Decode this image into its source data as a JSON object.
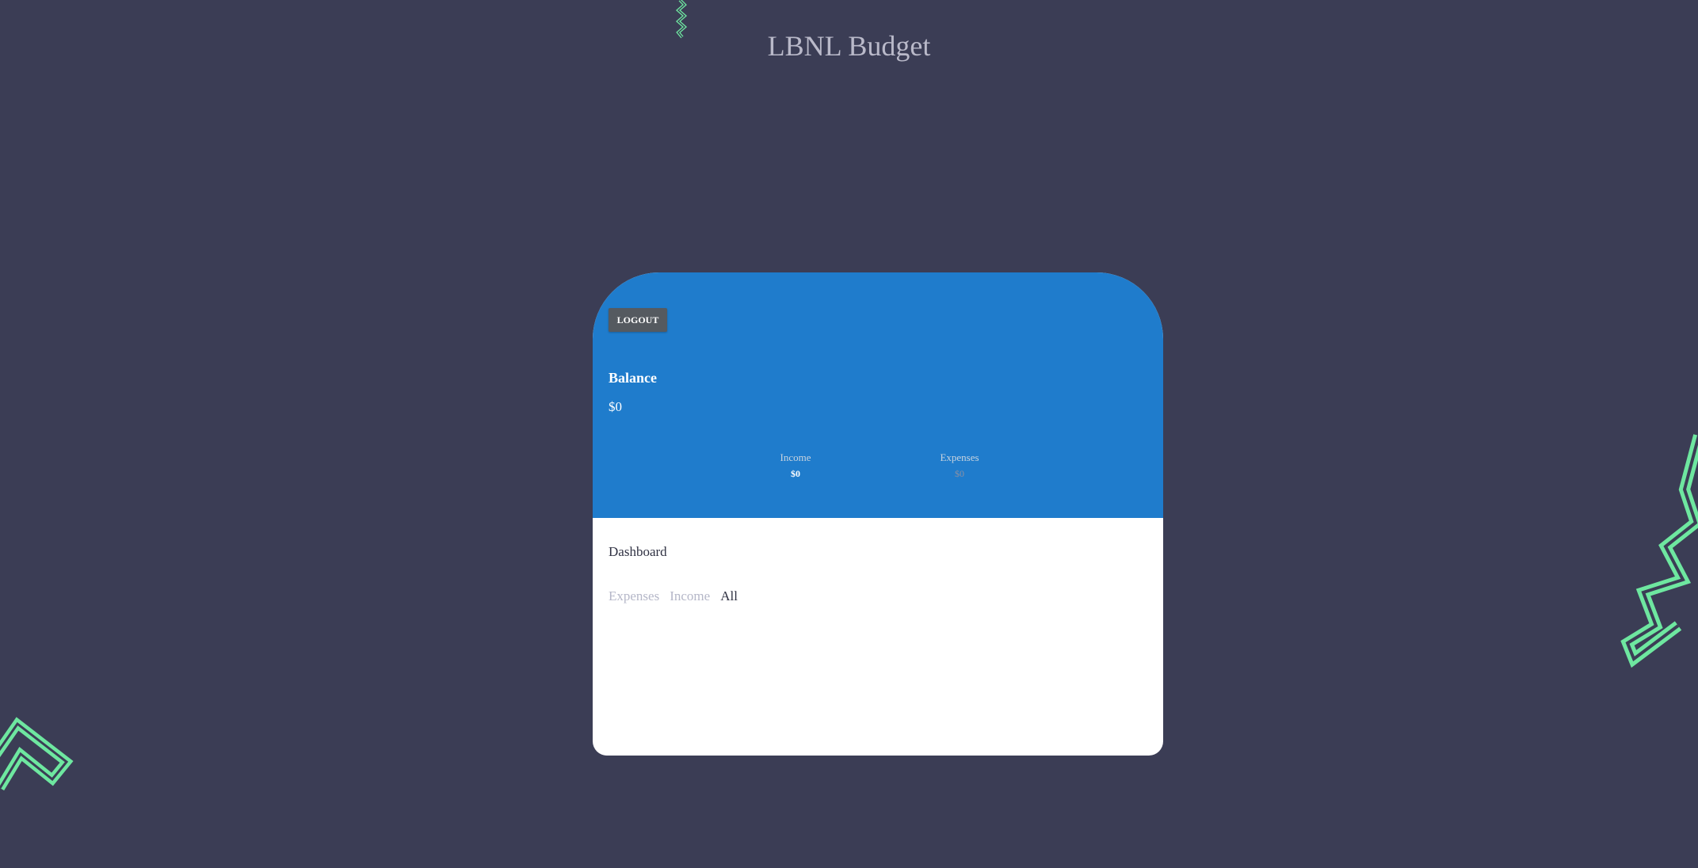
{
  "app": {
    "title": "LBNL Budget"
  },
  "header": {
    "logout_label": "LOGOUT",
    "balance_label": "Balance",
    "balance_value": "$0",
    "income_label": "Income",
    "income_value": "$0",
    "expenses_label": "Expenses",
    "expenses_value": "$0"
  },
  "dashboard": {
    "title": "Dashboard",
    "tabs": [
      {
        "label": "Expenses",
        "active": false
      },
      {
        "label": "Income",
        "active": false
      },
      {
        "label": "All",
        "active": true
      }
    ]
  },
  "colors": {
    "background": "#3b3d55",
    "accent_blue": "#1f7ccc",
    "decor_green": "#6ee7a0",
    "logout_button": "#555a60"
  },
  "icons": {
    "decor": "zigzag-decoration-icon"
  }
}
